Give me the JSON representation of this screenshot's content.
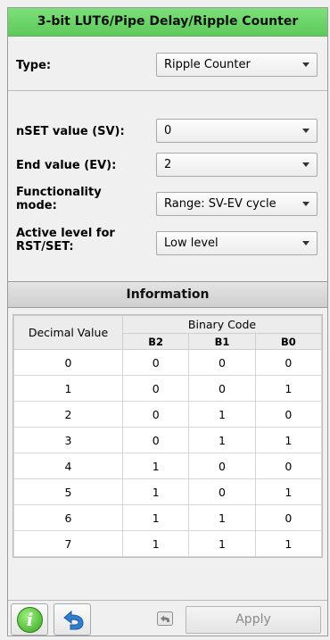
{
  "title": "3-bit LUT6/Pipe Delay/Ripple Counter",
  "type": {
    "label": "Type:",
    "value": "Ripple Counter"
  },
  "nset": {
    "label": "nSET value (SV):",
    "value": "0"
  },
  "end": {
    "label": "End value (EV):",
    "value": "2"
  },
  "functionality": {
    "label_line1": "Functionality",
    "label_line2": "mode:",
    "value": "Range: SV-EV cycle"
  },
  "active_level": {
    "label_line1": "Active level for",
    "label_line2": "RST/SET:",
    "value": "Low level"
  },
  "information": {
    "header": "Information",
    "table": {
      "decimal_header": "Decimal Value",
      "binary_header": "Binary Code",
      "bit_headers": [
        "B2",
        "B1",
        "B0"
      ],
      "rows": [
        [
          "0",
          "0",
          "0",
          "0"
        ],
        [
          "1",
          "0",
          "0",
          "1"
        ],
        [
          "2",
          "0",
          "1",
          "0"
        ],
        [
          "3",
          "0",
          "1",
          "1"
        ],
        [
          "4",
          "1",
          "0",
          "0"
        ],
        [
          "5",
          "1",
          "0",
          "1"
        ],
        [
          "6",
          "1",
          "1",
          "0"
        ],
        [
          "7",
          "1",
          "1",
          "1"
        ]
      ]
    }
  },
  "footer": {
    "info_icon_letter": "i",
    "apply_label": "Apply"
  },
  "colors": {
    "title_green": "#6fd66c",
    "info_icon_green": "#4cbf2c",
    "undo_blue": "#2f7fd0"
  }
}
